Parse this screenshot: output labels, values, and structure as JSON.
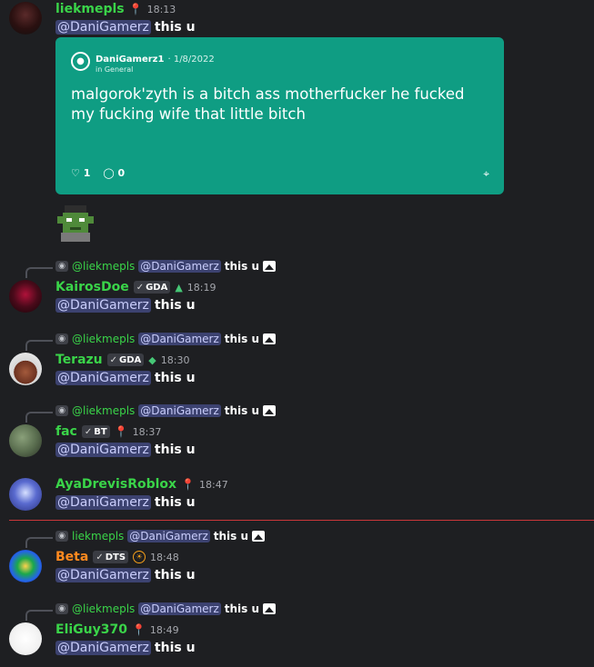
{
  "messages": [
    {
      "username": "liekmepls",
      "time": "18:13",
      "mention": "@DaniGamerz",
      "text": "this u",
      "embed": {
        "author": "DaniGamerz1",
        "date": "1/8/2022",
        "channel": "in General",
        "quote": "malgorok'zyth is a bitch ass motherfucker he fucked my fucking wife that little bitch",
        "likes": "1",
        "comments": "0"
      }
    },
    {
      "reply": {
        "username": "@liekmepls",
        "mention": "@DaniGamerz",
        "text": "this u"
      },
      "username": "KairosDoe",
      "tag": "GDA",
      "time": "18:19",
      "mention": "@DaniGamerz",
      "text": "this u"
    },
    {
      "reply": {
        "username": "@liekmepls",
        "mention": "@DaniGamerz",
        "text": "this u"
      },
      "username": "Terazu",
      "tag": "GDA",
      "time": "18:30",
      "mention": "@DaniGamerz",
      "text": "this u"
    },
    {
      "reply": {
        "username": "@liekmepls",
        "mention": "@DaniGamerz",
        "text": "this u"
      },
      "username": "fac",
      "tag": "BT",
      "time": "18:37",
      "mention": "@DaniGamerz",
      "text": "this u"
    },
    {
      "username": "AyaDrevisRoblox",
      "time": "18:47",
      "mention": "@DaniGamerz",
      "text": "this u"
    },
    {
      "reply": {
        "username": "liekmepls",
        "mention": "@DaniGamerz",
        "text": "this u"
      },
      "username": "Beta",
      "tag": "DTS",
      "time": "18:48",
      "mention": "@DaniGamerz",
      "text": "this u"
    },
    {
      "reply": {
        "username": "@liekmepls",
        "mention": "@DaniGamerz",
        "text": "this u"
      },
      "username": "EliGuy370",
      "time": "18:49",
      "mention": "@DaniGamerz",
      "text": "this u"
    }
  ],
  "colors": {
    "background": "#1e1f22",
    "username_green": "#3ad449",
    "username_orange": "#ff8a1f",
    "mention_bg": "#3c4270",
    "embed_bg": "#0f9d83",
    "new_divider": "#c9373a"
  },
  "icons": {
    "embed_author": "user-circle-icon",
    "like": "heart-icon",
    "comment": "comment-icon",
    "share": "share-icon",
    "reply_image": "image-icon",
    "badge": "sword-icon",
    "status": "pin-icon"
  }
}
